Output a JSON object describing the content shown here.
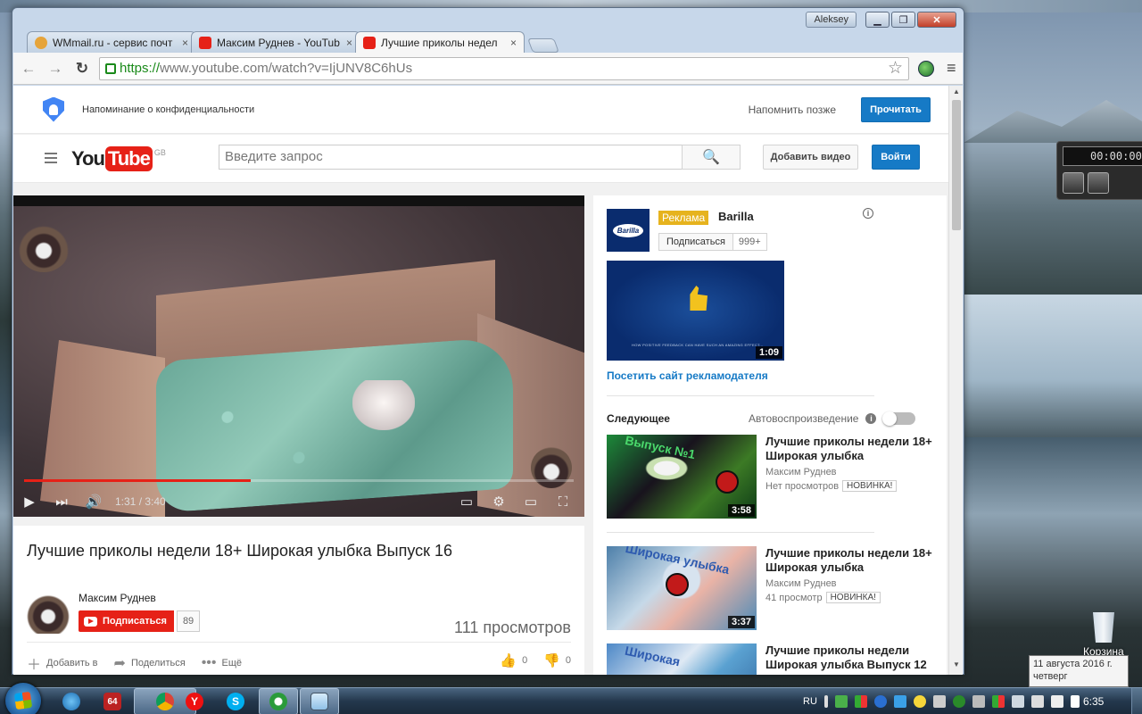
{
  "browser": {
    "user": "Aleksey",
    "tabs": [
      {
        "title": "WMmail.ru - сервис почт",
        "close": "×"
      },
      {
        "title": "Максим Руднев - YouTub",
        "close": "×"
      },
      {
        "title": "Лучшие приколы недел",
        "close": "×"
      }
    ],
    "url_scheme": "https://",
    "url_rest": "www.youtube.com/watch?v=IjUNV8C6hUs"
  },
  "privacy": {
    "text": "Напоминание о конфиденциальности",
    "remind_later": "Напомнить позже",
    "read": "Прочитать"
  },
  "masthead": {
    "logo_you": "You",
    "logo_tube": "Tube",
    "logo_region": "GB",
    "search_placeholder": "Введите запрос",
    "upload": "Добавить видео",
    "signin": "Войти"
  },
  "player": {
    "time": "1:31 / 3:40",
    "progress": 0.413
  },
  "video": {
    "title": "Лучшие приколы недели 18+ Широкая улыбка Выпуск 16",
    "owner": "Максим Руднев",
    "subscribe": "Подписаться",
    "sub_count": "89",
    "views": "111 просмотров",
    "add_to": "Добавить в",
    "share": "Поделиться",
    "more": "Ещё",
    "likes": "0",
    "dislikes": "0"
  },
  "ad": {
    "badge": "Реклама",
    "name": "Barilla",
    "logo_text": "Barilla",
    "subscribe": "Подписаться",
    "sub_count": "999+",
    "thumb_caption": "HOW POSITIVE FEEDBACK CAN HAVE SUCH AN AMAZING EFFECT...",
    "duration": "1:09",
    "visit": "Посетить сайт рекламодателя"
  },
  "up_next": {
    "heading": "Следующее",
    "autoplay": "Автовоспроизведение",
    "items": [
      {
        "title": "Лучшие приколы недели 18+ Широкая улыбка",
        "author": "Максим Руднев",
        "views": "Нет просмотров",
        "badge": "НОВИНКА!",
        "duration": "3:58",
        "thumb_text": "Выпуск №1"
      },
      {
        "title": "Лучшие приколы недели 18+ Широкая улыбка",
        "author": "Максим Руднев",
        "views": "41 просмотр",
        "badge": "НОВИНКА!",
        "duration": "3:37",
        "thumb_text": "Широкая улыбка"
      },
      {
        "title": "Лучшие приколы недели Широкая улыбка Выпуск 12",
        "author": "",
        "views": "",
        "badge": "",
        "duration": "",
        "thumb_text": "Широкая"
      }
    ]
  },
  "desktop": {
    "media_time": "00:00:00.",
    "recycle_bin": "Корзина",
    "tooltip_date": "11 августа 2016 г.",
    "tooltip_day": "четверг"
  },
  "taskbar": {
    "lang": "RU",
    "clock": "6:35",
    "badge_64": "64"
  }
}
